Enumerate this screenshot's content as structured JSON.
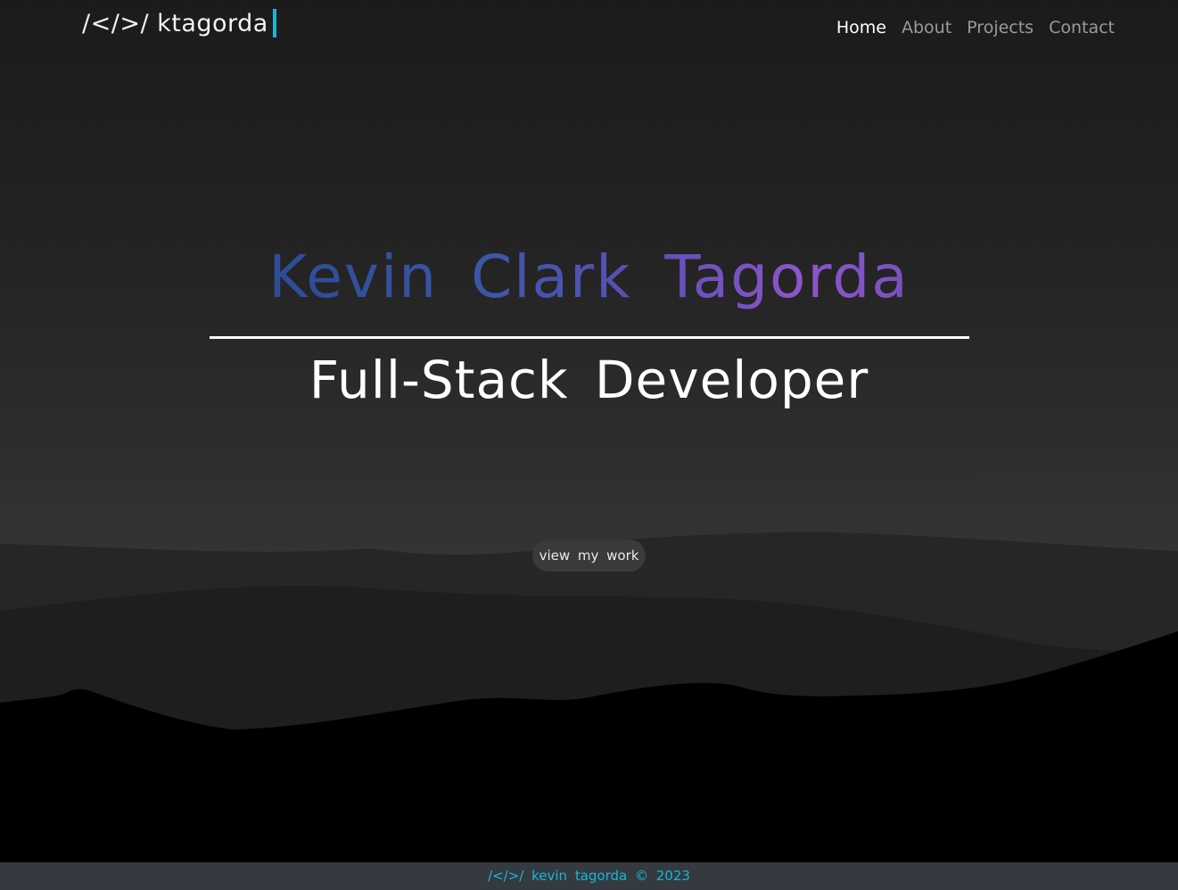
{
  "header": {
    "brand_text": "/</>/ ktagorda",
    "nav": [
      {
        "label": "Home",
        "active": true
      },
      {
        "label": "About",
        "active": false
      },
      {
        "label": "Projects",
        "active": false
      },
      {
        "label": "Contact",
        "active": false
      }
    ]
  },
  "hero": {
    "name": "Kevin Clark Tagorda",
    "title": "Full-Stack Developer",
    "cta_label": "view my work"
  },
  "footer": {
    "text": "/</>/ kevin tagorda © 2023"
  },
  "colors": {
    "accent": "#19b6d6",
    "footer_bg": "#343a40",
    "name_gradient_start": "#2a4180",
    "name_gradient_mid": "#8d55c8"
  }
}
